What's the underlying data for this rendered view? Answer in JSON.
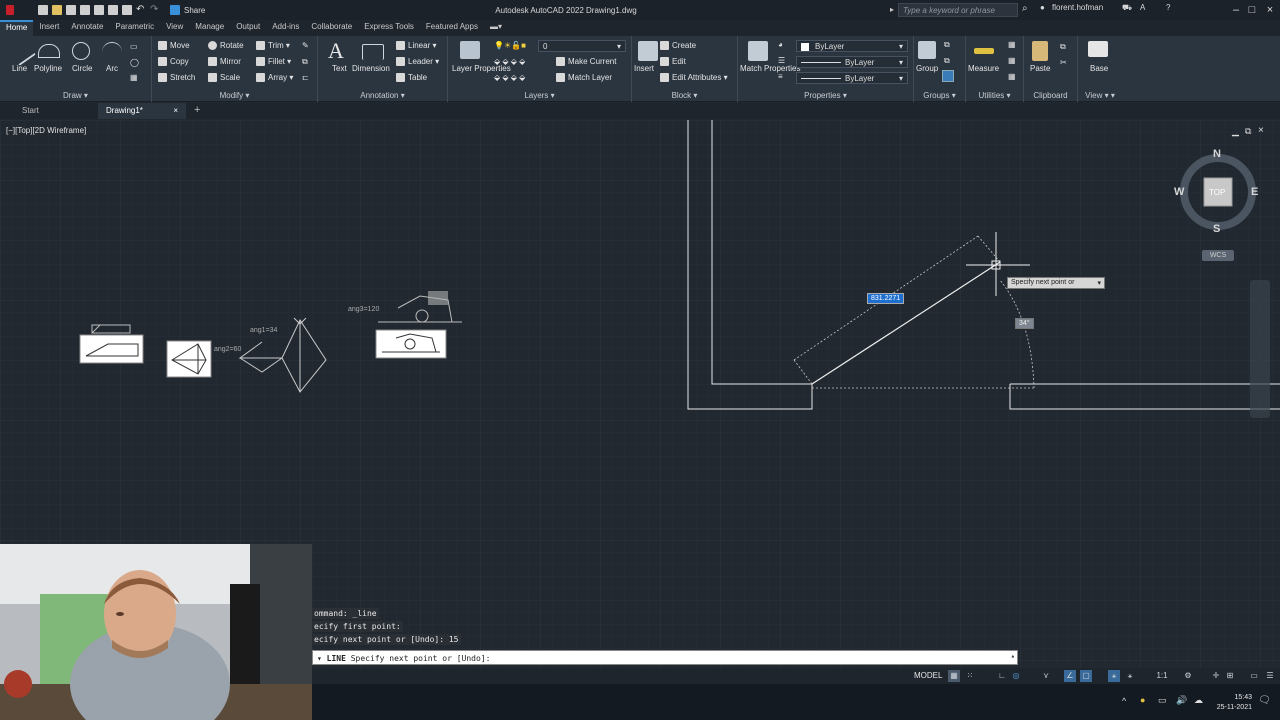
{
  "window": {
    "title": "Autodesk AutoCAD 2022   Drawing1.dwg",
    "share_label": "Share",
    "search_placeholder": "Type a keyword or phrase",
    "user": "florent.hofman"
  },
  "ribbon": {
    "tabs": [
      "Home",
      "Insert",
      "Annotate",
      "Parametric",
      "View",
      "Manage",
      "Output",
      "Add-ins",
      "Collaborate",
      "Express Tools",
      "Featured Apps"
    ],
    "active_tab": "Home",
    "draw": {
      "label": "Draw",
      "line": "Line",
      "polyline": "Polyline",
      "circle": "Circle",
      "arc": "Arc"
    },
    "modify": {
      "label": "Modify",
      "move": "Move",
      "rotate": "Rotate",
      "trim": "Trim",
      "copy": "Copy",
      "mirror": "Mirror",
      "fillet": "Fillet",
      "stretch": "Stretch",
      "scale": "Scale",
      "array": "Array"
    },
    "annotation": {
      "label": "Annotation",
      "text": "Text",
      "dimension": "Dimension",
      "linear": "Linear",
      "leader": "Leader",
      "table": "Table"
    },
    "layers": {
      "label": "Layers",
      "layer_properties": "Layer Properties",
      "current_layer": "0",
      "make_current": "Make Current",
      "match_layer": "Match Layer"
    },
    "block": {
      "label": "Block",
      "insert": "Insert",
      "create": "Create",
      "edit": "Edit",
      "edit_attributes": "Edit Attributes"
    },
    "properties": {
      "label": "Properties",
      "match_properties": "Match Properties",
      "color": "ByLayer",
      "linetype": "ByLayer",
      "lineweight": "ByLayer"
    },
    "groups": {
      "label": "Groups",
      "group": "Group"
    },
    "utilities": {
      "label": "Utilities",
      "measure": "Measure"
    },
    "clipboard": {
      "label": "Clipboard",
      "paste": "Paste"
    },
    "view": {
      "label": "View",
      "base": "Base"
    }
  },
  "file_tabs": {
    "start": "Start",
    "drawing": "Drawing1*"
  },
  "viewport": {
    "label": "[−][Top][2D Wireframe]",
    "viewcube": {
      "top": "TOP",
      "n": "N",
      "s": "S",
      "e": "E",
      "w": "W",
      "wcs": "WCS"
    },
    "dynamic_input": "831.2271",
    "prompt_tooltip": "Specify next point or",
    "angle_label": "34°",
    "annotations": {
      "ang1": "ang1=34",
      "ang2": "ang2=60",
      "ang3": "ang3=120"
    }
  },
  "command": {
    "history": [
      "ommand: _line",
      "ecify first point:",
      "ecify next point or [Undo]: 15"
    ],
    "current_cmd": "LINE",
    "current_prompt": "Specify next point or [Undo]:"
  },
  "statusbar": {
    "model": "MODEL",
    "scale": "1:1"
  },
  "taskbar": {
    "time": "15:43",
    "date": "25-11-2021"
  }
}
